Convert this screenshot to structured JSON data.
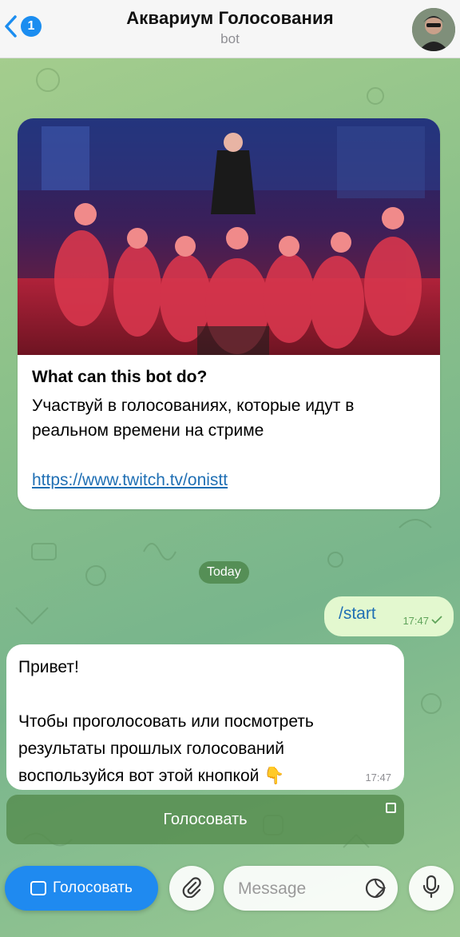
{
  "header": {
    "back_count": "1",
    "title": "Аквариум Голосования",
    "subtitle": "bot"
  },
  "intro": {
    "title": "What can this bot do?",
    "description": "Участвуй в голосованиях, которые идут в реальном времени на стриме",
    "link": "https://www.twitch.tv/onistt"
  },
  "date_separator": "Today",
  "outgoing": {
    "text": "/start",
    "time": "17:47"
  },
  "incoming": {
    "lines": [
      "Привет!",
      "",
      "Чтобы проголосовать или посмотреть",
      "результаты прошлых голосований",
      "воспользуйся вот этой кнопкой 👇"
    ],
    "time": "17:47"
  },
  "inline_button": {
    "label": "Голосовать"
  },
  "input_bar": {
    "menu_label": "Голосовать",
    "placeholder": "Message"
  },
  "colors": {
    "accent": "#1f8af0",
    "link": "#1f6fb4",
    "outgoing_bubble": "#e3f8cf",
    "check": "#5fa35a"
  },
  "icons": [
    "chevron-left-icon",
    "menu-icon",
    "paperclip-icon",
    "sticker-icon",
    "microphone-icon",
    "check-icon"
  ]
}
